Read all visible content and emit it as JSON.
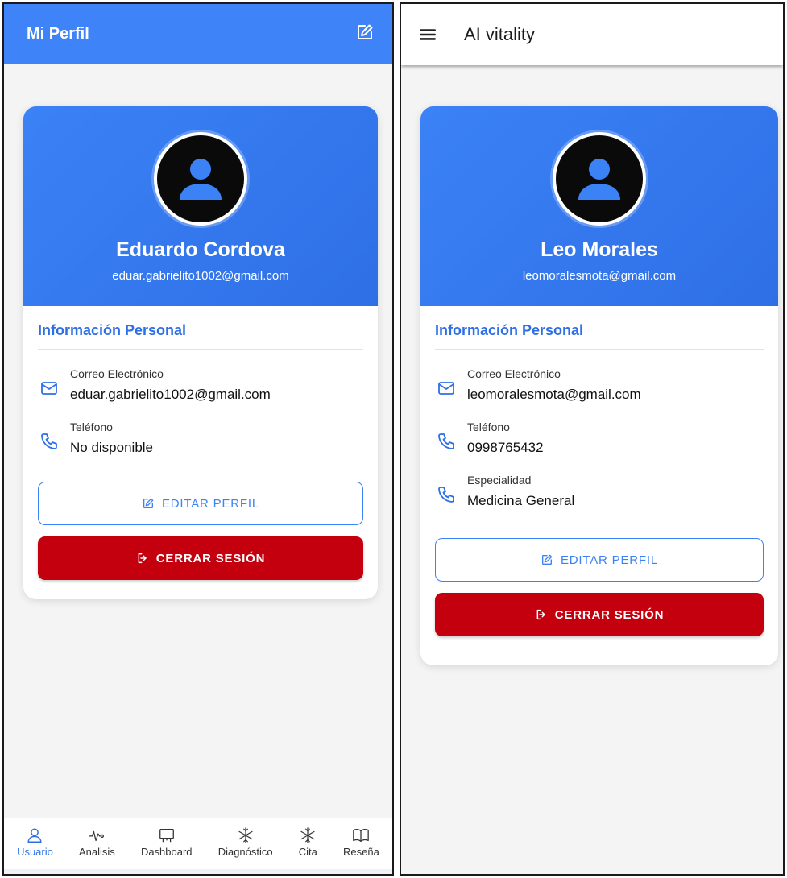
{
  "left": {
    "header": {
      "title": "Mi Perfil"
    },
    "profile": {
      "name": "Eduardo Cordova",
      "email": "eduar.gabrielito1002@gmail.com"
    },
    "section_title": "Información Personal",
    "fields": [
      {
        "label": "Correo Electrónico",
        "value": "eduar.gabrielito1002@gmail.com",
        "icon": "mail-icon"
      },
      {
        "label": "Teléfono",
        "value": "No disponible",
        "icon": "phone-icon"
      }
    ],
    "buttons": {
      "edit": "EDITAR PERFIL",
      "logout": "CERRAR SESIÓN"
    },
    "nav": [
      {
        "label": "Usuario",
        "icon": "user-icon",
        "active": true
      },
      {
        "label": "Analisis",
        "icon": "pulse-icon"
      },
      {
        "label": "Dashboard",
        "icon": "presentation-icon"
      },
      {
        "label": "Diagnóstico",
        "icon": "snowflake-icon"
      },
      {
        "label": "Cita",
        "icon": "snowflake-icon"
      },
      {
        "label": "Reseña",
        "icon": "book-icon"
      }
    ]
  },
  "right": {
    "header": {
      "title": "AI vitality"
    },
    "profile": {
      "name": "Leo Morales",
      "email": "leomoralesmota@gmail.com"
    },
    "section_title": "Información Personal",
    "fields": [
      {
        "label": "Correo Electrónico",
        "value": "leomoralesmota@gmail.com",
        "icon": "mail-icon"
      },
      {
        "label": "Teléfono",
        "value": "0998765432",
        "icon": "phone-icon"
      },
      {
        "label": "Especialidad",
        "value": "Medicina General",
        "icon": "phone-icon"
      }
    ],
    "buttons": {
      "edit": "EDITAR PERFIL",
      "logout": "CERRAR SESIÓN"
    }
  },
  "colors": {
    "primary": "#3b82f6",
    "header_blue": "#3f83f8",
    "danger": "#c4000f"
  }
}
